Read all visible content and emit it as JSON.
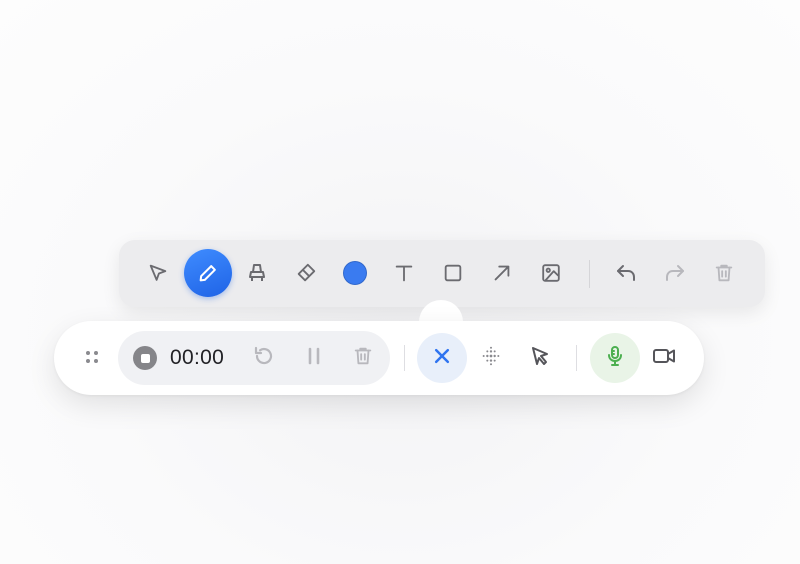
{
  "drawing_toolbar": {
    "tools": [
      {
        "name": "select",
        "icon": "pointer-arrow-icon",
        "active": false
      },
      {
        "name": "pen",
        "icon": "pencil-icon",
        "active": true
      },
      {
        "name": "highlighter",
        "icon": "highlighter-icon",
        "active": false
      },
      {
        "name": "eraser",
        "icon": "eraser-icon",
        "active": false
      },
      {
        "name": "color",
        "icon": "color-swatch-icon",
        "active": false
      },
      {
        "name": "text",
        "icon": "text-icon",
        "active": false
      },
      {
        "name": "rectangle",
        "icon": "rectangle-icon",
        "active": false
      },
      {
        "name": "arrow",
        "icon": "arrow-icon",
        "active": false
      },
      {
        "name": "image",
        "icon": "image-icon",
        "active": false
      },
      {
        "name": "undo",
        "icon": "undo-icon",
        "enabled": true
      },
      {
        "name": "redo",
        "icon": "redo-icon",
        "enabled": false
      },
      {
        "name": "clear",
        "icon": "trash-icon",
        "enabled": false
      }
    ],
    "selected_color": "#3a7bf0"
  },
  "recording_toolbar": {
    "timer": "00:00",
    "controls": [
      {
        "name": "stop",
        "icon": "stop-icon"
      },
      {
        "name": "restart",
        "icon": "restart-icon",
        "enabled": false
      },
      {
        "name": "pause",
        "icon": "pause-icon",
        "enabled": false
      },
      {
        "name": "delete",
        "icon": "trash-icon",
        "enabled": false
      }
    ],
    "actions": [
      {
        "name": "close-drawing",
        "icon": "close-icon",
        "active": true
      },
      {
        "name": "spotlight",
        "icon": "dot-grid-icon"
      },
      {
        "name": "cursor-highlight",
        "icon": "cursor-click-icon"
      },
      {
        "name": "microphone",
        "icon": "microphone-icon",
        "on": true
      },
      {
        "name": "camera",
        "icon": "video-camera-icon"
      }
    ]
  },
  "colors": {
    "accent": "#2f74f0",
    "mic_on": "#4caf50",
    "icon_default": "#6b6b70",
    "icon_disabled": "#b8b8bd"
  }
}
